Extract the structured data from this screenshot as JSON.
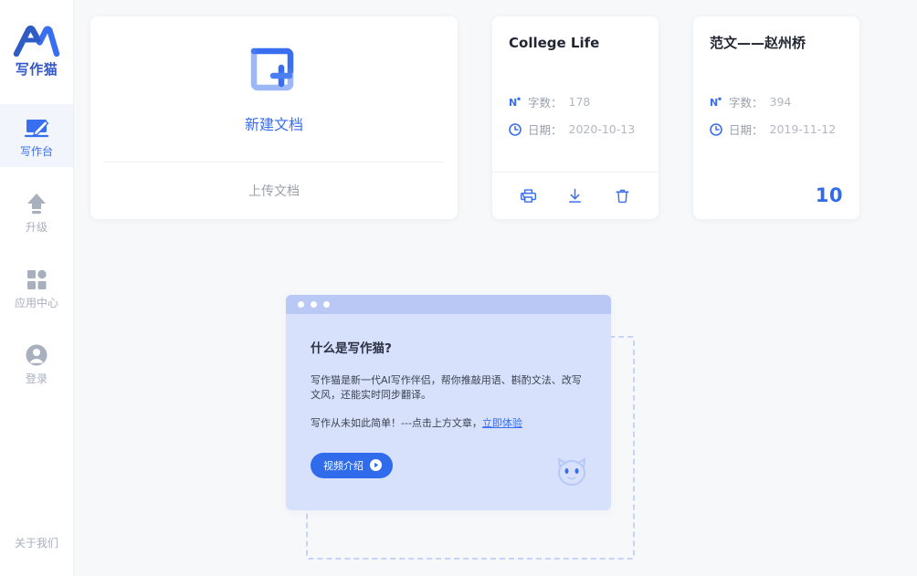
{
  "brand": {
    "name": "写作猫",
    "logo_icon": "ai-cat-logo-icon",
    "accent": "#3a6ef0",
    "logo_color": "#3257c8"
  },
  "sidebar": {
    "items": [
      {
        "label": "写作台",
        "icon": "writing-desk-icon",
        "active": true
      },
      {
        "label": "升级",
        "icon": "upgrade-arrow-icon",
        "active": false
      },
      {
        "label": "应用中心",
        "icon": "app-center-grid-icon",
        "active": false
      },
      {
        "label": "登录",
        "icon": "user-account-icon",
        "active": false
      }
    ],
    "footer_label": "关于我们"
  },
  "new_doc_card": {
    "icon": "new-document-plus-icon",
    "label": "新建文档",
    "upload_label": "上传文档"
  },
  "documents": [
    {
      "title": "College Life",
      "word_count_label": "字数：",
      "word_count": "178",
      "date_label": "日期：",
      "date": "2020-10-13",
      "word_icon": "word-count-icon",
      "date_icon": "clock-icon",
      "actions": [
        {
          "label": "打印",
          "icon": "print-icon"
        },
        {
          "label": "下载",
          "icon": "download-icon"
        },
        {
          "label": "删除",
          "icon": "trash-icon"
        }
      ],
      "count_badge": null
    },
    {
      "title": "范文——赵州桥",
      "word_count_label": "字数：",
      "word_count": "394",
      "date_label": "日期：",
      "date": "2019-11-12",
      "word_icon": "word-count-icon",
      "date_icon": "clock-icon",
      "actions": [],
      "count_badge": "10"
    }
  ],
  "promo": {
    "title": "什么是写作猫?",
    "paragraph1": "写作猫是新一代AI写作伴侣，帮你推敲用语、斟酌文法、改写文风，还能实时同步翻译。",
    "paragraph2_prefix": "写作从未如此简单！---点击上方文章，",
    "paragraph2_link": "立即体验",
    "button_label": "视频介绍",
    "button_icon": "play-icon",
    "mascot_icon": "cat-face-icon",
    "window_dots": 3,
    "bar_color": "#b9c8f5",
    "body_color": "#d7e1fb"
  }
}
